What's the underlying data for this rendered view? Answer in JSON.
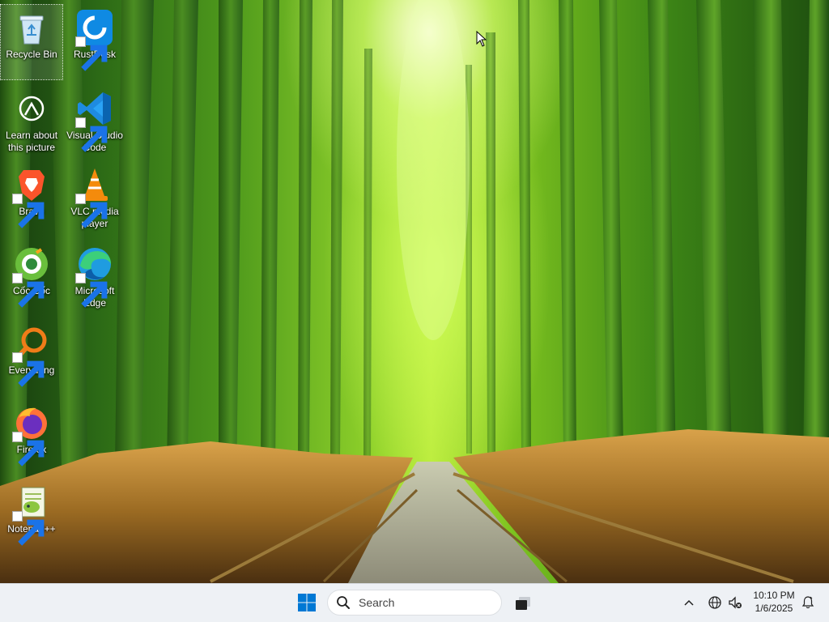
{
  "desktop": {
    "icons": [
      {
        "label": "Recycle Bin",
        "icon": "recycle-bin-icon"
      },
      {
        "label": "RustDesk",
        "icon": "rustdesk-icon"
      },
      {
        "label": "Learn about this picture",
        "icon": "learn-about-picture-icon"
      },
      {
        "label": "Visual Studio Code",
        "icon": "vscode-icon"
      },
      {
        "label": "Brave",
        "icon": "brave-icon"
      },
      {
        "label": "VLC media player",
        "icon": "vlc-icon"
      },
      {
        "label": "Cốc Cốc",
        "icon": "coccoc-icon"
      },
      {
        "label": "Microsoft Edge",
        "icon": "edge-icon"
      },
      {
        "label": "Everything",
        "icon": "everything-icon"
      },
      {
        "label": "Firefox",
        "icon": "firefox-icon"
      },
      {
        "label": "Notepad++",
        "icon": "notepadpp-icon"
      }
    ]
  },
  "taskbar": {
    "search_placeholder": "Search",
    "clock_time": "10:10 PM",
    "clock_date": "1/6/2025",
    "colors": {
      "background": "#eef1f5",
      "windows_blue": "#0078d4"
    }
  }
}
